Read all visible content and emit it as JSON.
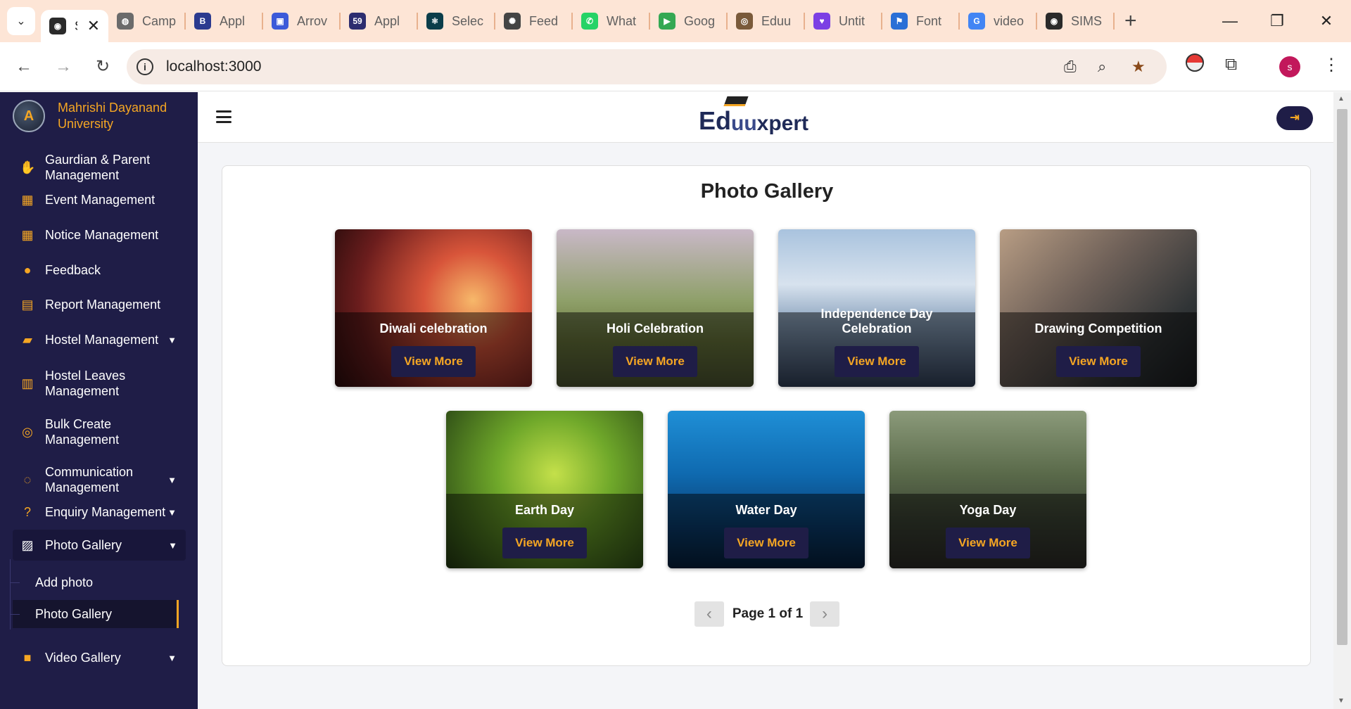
{
  "browser": {
    "tabs": [
      {
        "label": "S",
        "color": "#2a2a2a",
        "glyph": "◉"
      },
      {
        "label": "Camp",
        "color": "#6b6b6b",
        "glyph": "◍"
      },
      {
        "label": "Appl",
        "color": "#2b3a8f",
        "glyph": "B"
      },
      {
        "label": "Arrov",
        "color": "#3b5ad9",
        "glyph": "▣"
      },
      {
        "label": "Appl",
        "color": "#2d2d6f",
        "glyph": "59"
      },
      {
        "label": "Selec",
        "color": "#0b3d4a",
        "glyph": "⚛"
      },
      {
        "label": "Feed",
        "color": "#444444",
        "glyph": "✺"
      },
      {
        "label": "What",
        "color": "#25d366",
        "glyph": "✆"
      },
      {
        "label": "Goog",
        "color": "#34a853",
        "glyph": "▶"
      },
      {
        "label": "Eduu",
        "color": "#7a5a3a",
        "glyph": "◎"
      },
      {
        "label": "Untit",
        "color": "#7b3fe4",
        "glyph": "♥"
      },
      {
        "label": "Font",
        "color": "#2a6fd6",
        "glyph": "⚑"
      },
      {
        "label": "video",
        "color": "#4285f4",
        "glyph": "G"
      },
      {
        "label": "SIMS",
        "color": "#2a2a2a",
        "glyph": "◉"
      }
    ],
    "url": "localhost:3000",
    "profile_initial": "s"
  },
  "sidebar": {
    "university": "Mahrishi Dayanand University",
    "items": [
      {
        "label": "Gaurdian & Parent Management",
        "icon": "hands-icon",
        "glyph": "✋",
        "caret": false
      },
      {
        "label": "Event Management",
        "icon": "calendar-icon",
        "glyph": "▦",
        "caret": false
      },
      {
        "label": "Notice Management",
        "icon": "calendar-icon",
        "glyph": "▦",
        "caret": false
      },
      {
        "label": "Feedback",
        "icon": "chat-bubble-icon",
        "glyph": "●",
        "caret": false
      },
      {
        "label": "Report Management",
        "icon": "report-icon",
        "glyph": "▤",
        "caret": false
      },
      {
        "label": "Hostel Management",
        "icon": "note-icon",
        "glyph": "▰",
        "caret": true
      },
      {
        "label": "Hostel Leaves Management",
        "icon": "building-icon",
        "glyph": "▥",
        "caret": false
      },
      {
        "label": "Bulk Create Management",
        "icon": "coin-icon",
        "glyph": "◎",
        "caret": false
      },
      {
        "label": "Communication Management",
        "icon": "comment-dots-icon",
        "glyph": "◌",
        "caret": true
      },
      {
        "label": "Enquiry Management",
        "icon": "question-icon",
        "glyph": "?",
        "caret": true
      },
      {
        "label": "Photo Gallery",
        "icon": "image-icon",
        "glyph": "▨",
        "caret": true
      },
      {
        "label": "Video Gallery",
        "icon": "video-camera-icon",
        "glyph": "■",
        "caret": true
      }
    ],
    "sub_items": [
      "Add photo",
      "Photo Gallery"
    ]
  },
  "header": {
    "logo_text_1": "Ed",
    "logo_text_2": "uu",
    "logo_text_3": "xpert"
  },
  "gallery": {
    "title": "Photo Gallery",
    "button_label": "View More",
    "photos": [
      {
        "title": "Diwali celebration",
        "icon": "diwali-photo"
      },
      {
        "title": "Holi Celebration",
        "icon": "holi-photo"
      },
      {
        "title": "Independence Day Celebration",
        "icon": "flag-photo"
      },
      {
        "title": "Drawing Competition",
        "icon": "drawing-photo"
      },
      {
        "title": "Earth Day",
        "icon": "plant-photo"
      },
      {
        "title": "Water Day",
        "icon": "ocean-photo"
      },
      {
        "title": "Yoga Day",
        "icon": "yoga-photo"
      }
    ],
    "pager_text": "Page 1 of 1"
  }
}
